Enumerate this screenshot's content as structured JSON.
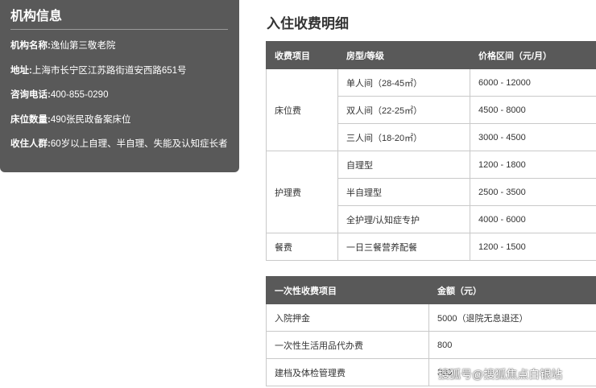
{
  "info": {
    "title": "机构信息",
    "rows": [
      {
        "label": "机构名称:",
        "value": "逸仙第三敬老院"
      },
      {
        "label": "地址:",
        "value": "上海市长宁区江苏路街道安西路651号"
      },
      {
        "label": "咨询电话:",
        "value": "400-855-0290"
      },
      {
        "label": "床位数量:",
        "value": "490张民政备案床位"
      },
      {
        "label": "收住人群:",
        "value": "60岁以上自理、半自理、失能及认知症长者"
      }
    ]
  },
  "fees": {
    "title": "入住收费明细",
    "headers": [
      "收费项目",
      "房型/等级",
      "价格区间（元/月）"
    ],
    "groups": [
      {
        "category": "床位费",
        "rows": [
          {
            "type": "单人间（28-45㎡）",
            "price": "6000 - 12000"
          },
          {
            "type": "双人间（22-25㎡）",
            "price": "4500 - 8000"
          },
          {
            "type": "三人间（18-20㎡）",
            "price": "3000 - 4500"
          }
        ]
      },
      {
        "category": "护理费",
        "rows": [
          {
            "type": "自理型",
            "price": "1200 - 1800"
          },
          {
            "type": "半自理型",
            "price": "2500 - 3500"
          },
          {
            "type": "全护理/认知症专护",
            "price": "4000 - 6000"
          }
        ]
      },
      {
        "category": "餐费",
        "rows": [
          {
            "type": "一日三餐营养配餐",
            "price": "1200 - 1500"
          }
        ]
      }
    ]
  },
  "one_time": {
    "headers": [
      "一次性收费项目",
      "金额（元）"
    ],
    "rows": [
      {
        "item": "入院押金",
        "amount": "5000（退院无息退还）"
      },
      {
        "item": "一次性生活用品代办费",
        "amount": "800"
      },
      {
        "item": "建档及体检管理费",
        "amount": "300"
      }
    ]
  },
  "watermark": "搜狐号@搜狐焦点白银站"
}
